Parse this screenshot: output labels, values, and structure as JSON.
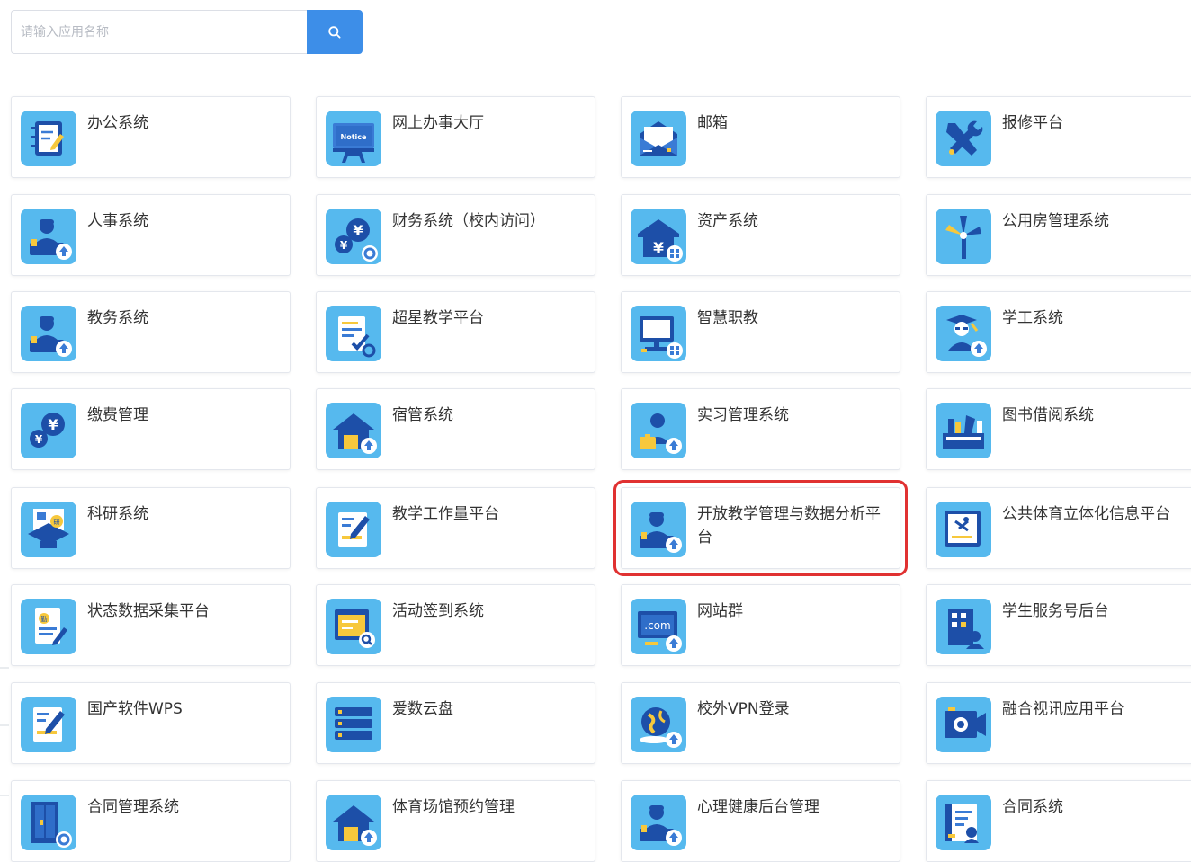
{
  "search": {
    "placeholder": "请输入应用名称",
    "value": ""
  },
  "accent_color": "#3d8ee8",
  "highlight_color": "#e03131",
  "selected_app": "开放教学管理与数据分析平台",
  "apps": [
    {
      "label": "办公系统",
      "icon": "notebook-icon"
    },
    {
      "label": "网上办事大厅",
      "icon": "notice-board-icon"
    },
    {
      "label": "邮箱",
      "icon": "mail-icon"
    },
    {
      "label": "报修平台",
      "icon": "repair-tools-icon"
    },
    {
      "label": "人事系统",
      "icon": "staff-desk-icon"
    },
    {
      "label": "财务系统（校内访问）",
      "icon": "finance-coins-icon"
    },
    {
      "label": "资产系统",
      "icon": "asset-house-icon"
    },
    {
      "label": "公用房管理系统",
      "icon": "windmill-icon"
    },
    {
      "label": "教务系统",
      "icon": "staff-desk-icon"
    },
    {
      "label": "超星教学平台",
      "icon": "document-check-icon"
    },
    {
      "label": "智慧职教",
      "icon": "computer-icon"
    },
    {
      "label": "学工系统",
      "icon": "graduate-icon"
    },
    {
      "label": "缴费管理",
      "icon": "coins-icon"
    },
    {
      "label": "宿管系统",
      "icon": "house-icon"
    },
    {
      "label": "实习管理系统",
      "icon": "intern-briefcase-icon"
    },
    {
      "label": "图书借阅系统",
      "icon": "bookshelf-icon"
    },
    {
      "label": "科研系统",
      "icon": "research-icon"
    },
    {
      "label": "教学工作量平台",
      "icon": "document-pen-icon"
    },
    {
      "label": "开放教学管理与数据分析平台",
      "icon": "staff-desk-icon"
    },
    {
      "label": "公共体育立体化信息平台",
      "icon": "sports-doc-icon"
    },
    {
      "label": "状态数据采集平台",
      "icon": "data-collect-icon"
    },
    {
      "label": "活动签到系统",
      "icon": "checkin-board-icon"
    },
    {
      "label": "网站群",
      "icon": "dotcom-icon"
    },
    {
      "label": "学生服务号后台",
      "icon": "service-building-icon"
    },
    {
      "label": "国产软件WPS",
      "icon": "document-pen-icon"
    },
    {
      "label": "爱数云盘",
      "icon": "server-stack-icon"
    },
    {
      "label": "校外VPN登录",
      "icon": "globe-icon"
    },
    {
      "label": "融合视讯应用平台",
      "icon": "camera-icon"
    },
    {
      "label": "合同管理系统",
      "icon": "cabinet-gear-icon"
    },
    {
      "label": "体育场馆预约管理",
      "icon": "house-icon"
    },
    {
      "label": "心理健康后台管理",
      "icon": "staff-desk-icon"
    },
    {
      "label": "合同系统",
      "icon": "contract-icon"
    }
  ]
}
